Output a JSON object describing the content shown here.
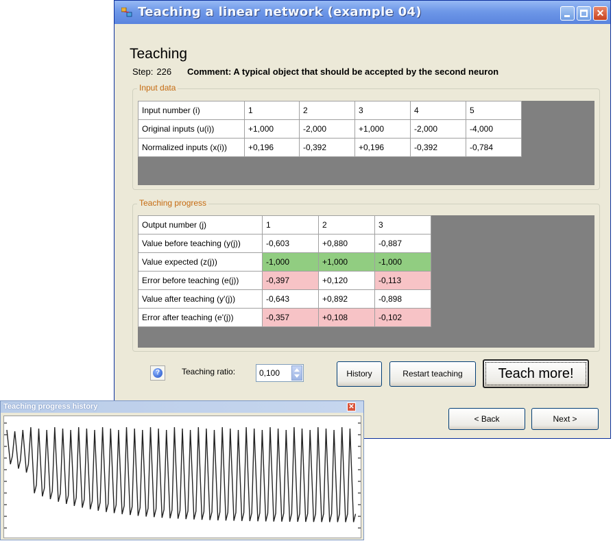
{
  "window": {
    "title": "Teaching a linear network (example 04)",
    "heading": "Teaching",
    "step_label": "Step:",
    "step_value": "226",
    "comment": "Comment: A typical object that should be accepted by the second neuron"
  },
  "input_data": {
    "legend": "Input data",
    "rows": [
      {
        "label": "Input number (i)",
        "cells": [
          "1",
          "2",
          "3",
          "4",
          "5"
        ]
      },
      {
        "label": "Original inputs (u(i))",
        "cells": [
          "+1,000",
          "-2,000",
          "+1,000",
          "-2,000",
          "-4,000"
        ]
      },
      {
        "label": "Normalized inputs (x(i))",
        "cells": [
          "+0,196",
          "-0,392",
          "+0,196",
          "-0,392",
          "-0,784"
        ]
      }
    ]
  },
  "teaching_progress": {
    "legend": "Teaching progress",
    "rows": [
      {
        "label": "Output number (j)",
        "cells": [
          "1",
          "2",
          "3"
        ],
        "highlight": [
          "none",
          "none",
          "none"
        ]
      },
      {
        "label": "Value before teaching (y(j))",
        "cells": [
          "-0,603",
          "+0,880",
          "-0,887"
        ],
        "highlight": [
          "none",
          "none",
          "none"
        ]
      },
      {
        "label": "Value expected (z(j))",
        "cells": [
          "-1,000",
          "+1,000",
          "-1,000"
        ],
        "highlight": [
          "green",
          "green",
          "green"
        ]
      },
      {
        "label": "Error before teaching (e(j))",
        "cells": [
          "-0,397",
          "+0,120",
          "-0,113"
        ],
        "highlight": [
          "pink",
          "none",
          "pink"
        ]
      },
      {
        "label": "Value after teaching (y'(j))",
        "cells": [
          "-0,643",
          "+0,892",
          "-0,898"
        ],
        "highlight": [
          "none",
          "none",
          "none"
        ]
      },
      {
        "label": "Error after teaching (e'(j))",
        "cells": [
          "-0,357",
          "+0,108",
          "-0,102"
        ],
        "highlight": [
          "pink",
          "pink",
          "pink"
        ]
      }
    ]
  },
  "controls": {
    "ratio_label": "Teaching ratio:",
    "ratio_value": "0,100",
    "history_label": "History",
    "restart_label": "Restart teaching",
    "teach_label": "Teach more!",
    "back_label": "< Back",
    "next_label": "Next >"
  },
  "history_window": {
    "title": "Teaching progress history"
  },
  "colors": {
    "title_bar": "#6e98e8",
    "expected_highlight": "#91cd81",
    "error_highlight": "#f7c3c6",
    "grid_background": "#808080",
    "legend_text": "#c56a10"
  },
  "icons": [
    "app-icon",
    "minimize-icon",
    "maximize-icon",
    "close-icon",
    "help-icon",
    "spin-up-icon",
    "spin-down-icon",
    "close-icon"
  ]
}
